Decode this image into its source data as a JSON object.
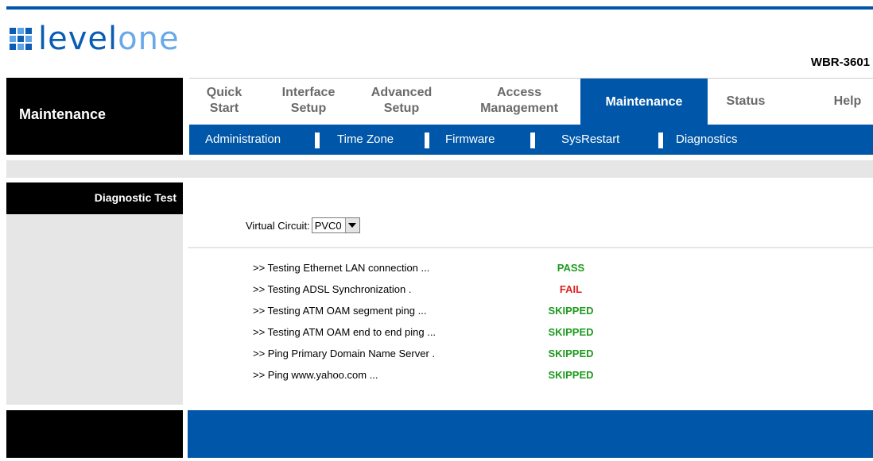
{
  "brand": {
    "logo_main": "level",
    "logo_two": "one",
    "model": "WBR-3601"
  },
  "header": {
    "section_title": "Maintenance"
  },
  "menu": [
    {
      "line1": "Quick",
      "line2": "Start"
    },
    {
      "line1": "Interface",
      "line2": "Setup"
    },
    {
      "line1": "Advanced",
      "line2": "Setup"
    },
    {
      "line1": "Access",
      "line2": "Management"
    },
    {
      "line1": "Maintenance",
      "line2": ""
    },
    {
      "line1": "Status",
      "line2": ""
    },
    {
      "line1": "Help",
      "line2": ""
    }
  ],
  "submenu": [
    "Administration",
    "Time Zone",
    "Firmware",
    "SysRestart",
    "Diagnostics"
  ],
  "sidebar": {
    "label": "Diagnostic Test"
  },
  "form": {
    "vc_label": "Virtual Circuit:",
    "vc_value": "PVC0"
  },
  "tests": [
    {
      "label": ">> Testing Ethernet LAN connection ...",
      "result": "PASS"
    },
    {
      "label": ">> Testing ADSL Synchronization .",
      "result": "FAIL"
    },
    {
      "label": ">> Testing ATM OAM segment ping ...",
      "result": "SKIPPED"
    },
    {
      "label": ">> Testing ATM OAM end to end ping ...",
      "result": "SKIPPED"
    },
    {
      "label": ">> Ping Primary Domain Name Server .",
      "result": "SKIPPED"
    },
    {
      "label": ">> Ping www.yahoo.com ...",
      "result": "SKIPPED"
    }
  ],
  "colors": {
    "accent": "#0056a8",
    "pass": "#1f9a1f",
    "fail": "#e02020"
  }
}
